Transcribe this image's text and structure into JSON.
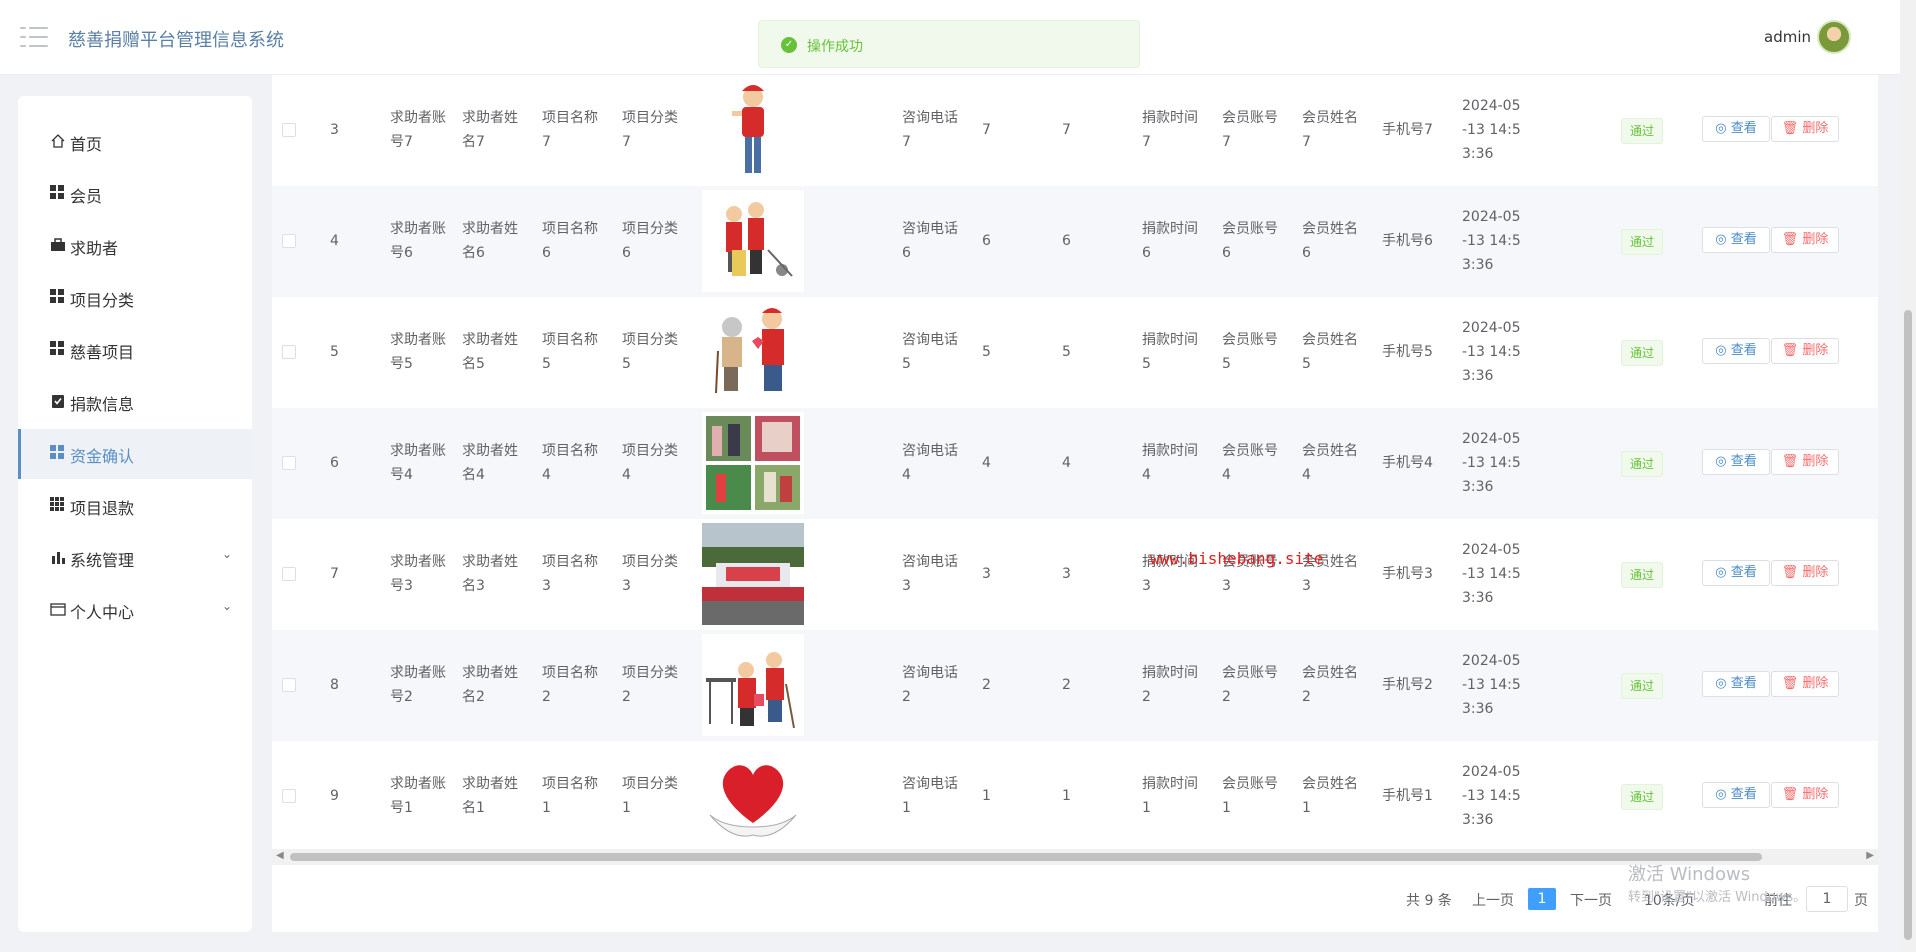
{
  "header": {
    "title": "慈善捐赠平台管理信息系统",
    "toast": "操作成功",
    "user": "admin"
  },
  "sidebar": {
    "items": [
      {
        "label": "首页",
        "icon": "home-icon"
      },
      {
        "label": "会员",
        "icon": "grid-icon"
      },
      {
        "label": "求助者",
        "icon": "briefcase-icon"
      },
      {
        "label": "项目分类",
        "icon": "grid-icon"
      },
      {
        "label": "慈善项目",
        "icon": "grid-icon"
      },
      {
        "label": "捐款信息",
        "icon": "clipboard-check-icon"
      },
      {
        "label": "资金确认",
        "icon": "grid-icon",
        "active": true
      },
      {
        "label": "项目退款",
        "icon": "grid9-icon"
      },
      {
        "label": "系统管理",
        "icon": "bar-chart-icon",
        "expandable": true
      },
      {
        "label": "个人中心",
        "icon": "card-icon",
        "expandable": true
      }
    ]
  },
  "table": {
    "rows": [
      {
        "index": "3",
        "account": [
          "求助者账",
          "号7"
        ],
        "name": [
          "求助者姓",
          "名7"
        ],
        "project": [
          "项目名称",
          "7"
        ],
        "category": [
          "项目分类",
          "7"
        ],
        "image": "volunteer-girl",
        "phone": [
          "咨询电话",
          "7"
        ],
        "c1": "7",
        "c2": "7",
        "time": [
          "捐款时间",
          "7"
        ],
        "maccount": [
          "会员账号",
          "7"
        ],
        "mname": [
          "会员姓名",
          "7"
        ],
        "mobile": "手机号7",
        "date": [
          "2024-05",
          "-13 14:5",
          "3:36"
        ],
        "status": "通过"
      },
      {
        "index": "4",
        "account": [
          "求助者账",
          "号6"
        ],
        "name": [
          "求助者姓",
          "名6"
        ],
        "project": [
          "项目名称",
          "6"
        ],
        "category": [
          "项目分类",
          "6"
        ],
        "image": "volunteers-cleaning",
        "phone": [
          "咨询电话",
          "6"
        ],
        "c1": "6",
        "c2": "6",
        "time": [
          "捐款时间",
          "6"
        ],
        "maccount": [
          "会员账号",
          "6"
        ],
        "mname": [
          "会员姓名",
          "6"
        ],
        "mobile": "手机号6",
        "date": [
          "2024-05",
          "-13 14:5",
          "3:36"
        ],
        "status": "通过"
      },
      {
        "index": "5",
        "account": [
          "求助者账",
          "号5"
        ],
        "name": [
          "求助者姓",
          "名5"
        ],
        "project": [
          "项目名称",
          "5"
        ],
        "category": [
          "项目分类",
          "5"
        ],
        "image": "helping-elderly",
        "phone": [
          "咨询电话",
          "5"
        ],
        "c1": "5",
        "c2": "5",
        "time": [
          "捐款时间",
          "5"
        ],
        "maccount": [
          "会员账号",
          "5"
        ],
        "mname": [
          "会员姓名",
          "5"
        ],
        "mobile": "手机号5",
        "date": [
          "2024-05",
          "-13 14:5",
          "3:36"
        ],
        "status": "通过"
      },
      {
        "index": "6",
        "account": [
          "求助者账",
          "号4"
        ],
        "name": [
          "求助者姓",
          "名4"
        ],
        "project": [
          "项目名称",
          "4"
        ],
        "category": [
          "项目分类",
          "4"
        ],
        "image": "photo-collage",
        "phone": [
          "咨询电话",
          "4"
        ],
        "c1": "4",
        "c2": "4",
        "time": [
          "捐款时间",
          "4"
        ],
        "maccount": [
          "会员账号",
          "4"
        ],
        "mname": [
          "会员姓名",
          "4"
        ],
        "mobile": "手机号4",
        "date": [
          "2024-05",
          "-13 14:5",
          "3:36"
        ],
        "status": "通过"
      },
      {
        "index": "7",
        "account": [
          "求助者账",
          "号3"
        ],
        "name": [
          "求助者姓",
          "名3"
        ],
        "project": [
          "项目名称",
          "3"
        ],
        "category": [
          "项目分类",
          "3"
        ],
        "image": "outdoor-stage",
        "phone": [
          "咨询电话",
          "3"
        ],
        "c1": "3",
        "c2": "3",
        "time": [
          "捐款时间",
          "3"
        ],
        "maccount": [
          "会员账号",
          "3"
        ],
        "mname": [
          "会员姓名",
          "3"
        ],
        "mobile": "手机号3",
        "date": [
          "2024-05",
          "-13 14:5",
          "3:36"
        ],
        "status": "通过"
      },
      {
        "index": "8",
        "account": [
          "求助者账",
          "号2"
        ],
        "name": [
          "求助者姓",
          "名2"
        ],
        "project": [
          "项目名称",
          "2"
        ],
        "category": [
          "项目分类",
          "2"
        ],
        "image": "volunteers-sweeping",
        "phone": [
          "咨询电话",
          "2"
        ],
        "c1": "2",
        "c2": "2",
        "time": [
          "捐款时间",
          "2"
        ],
        "maccount": [
          "会员账号",
          "2"
        ],
        "mname": [
          "会员姓名",
          "2"
        ],
        "mobile": "手机号2",
        "date": [
          "2024-05",
          "-13 14:5",
          "3:36"
        ],
        "status": "通过"
      },
      {
        "index": "9",
        "account": [
          "求助者账",
          "号1"
        ],
        "name": [
          "求助者姓",
          "名1"
        ],
        "project": [
          "项目名称",
          "1"
        ],
        "category": [
          "项目分类",
          "1"
        ],
        "image": "heart-in-hands",
        "phone": [
          "咨询电话",
          "1"
        ],
        "c1": "1",
        "c2": "1",
        "time": [
          "捐款时间",
          "1"
        ],
        "maccount": [
          "会员账号",
          "1"
        ],
        "mname": [
          "会员姓名",
          "1"
        ],
        "mobile": "手机号1",
        "date": [
          "2024-05",
          "-13 14:5",
          "3:36"
        ],
        "status": "通过"
      }
    ],
    "view_label": "查看",
    "delete_label": "删除",
    "watermark": "www.bishebang.site"
  },
  "pagination": {
    "total": "共 9 条",
    "prev": "上一页",
    "current": "1",
    "next": "下一页",
    "page_size": "10条/页",
    "goto": "前往",
    "goto_value": "1",
    "page_unit": "页"
  },
  "system": {
    "activate_title": "激活 Windows",
    "activate_sub": "转到\"设置\"以激活 Windows。"
  },
  "colors": {
    "accent": "#5a8fc6",
    "success": "#67c23a",
    "danger": "#f56c6c",
    "pagination": "#409eff"
  }
}
